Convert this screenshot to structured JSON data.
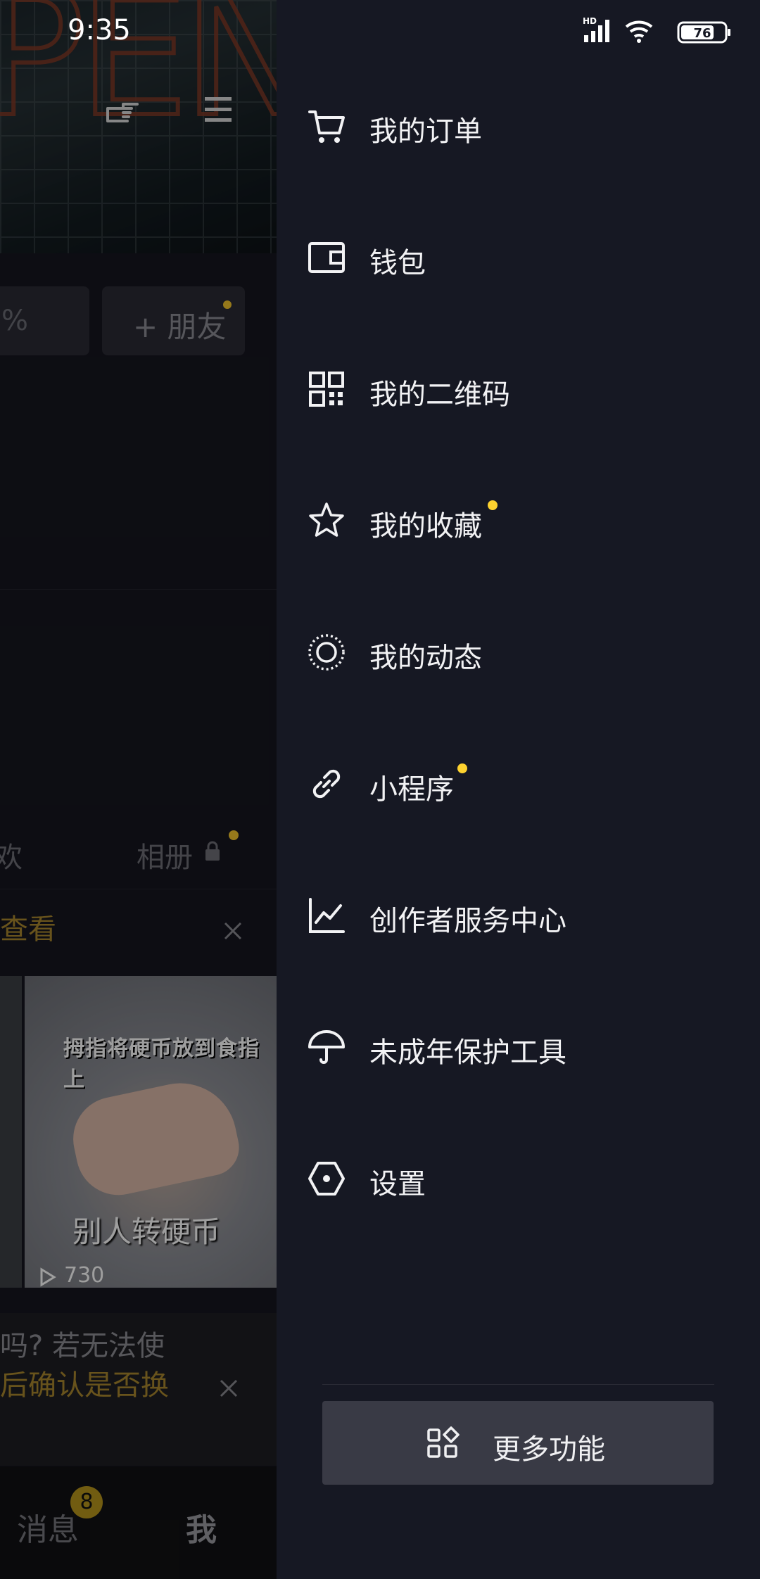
{
  "status_bar": {
    "time": "9:35",
    "battery": "76",
    "network": "HD"
  },
  "background_page": {
    "pill_left_text": "%",
    "add_friend_label": "+ 朋友",
    "tab_partial": "欢",
    "tab_album": "相册",
    "promo_text": "查看",
    "video": {
      "caption_top": "拇指将硬币放到食指上",
      "caption_bottom": "别人转硬币",
      "plays": "730"
    },
    "notice_line1": "吗? 若无法使",
    "notice_line2": "后确认是否换",
    "nav_messages": "消息",
    "nav_messages_badge": "8",
    "nav_me": "我"
  },
  "drawer": {
    "items": [
      {
        "label": "我的订单",
        "icon": "cart-icon"
      },
      {
        "label": "钱包",
        "icon": "wallet-icon"
      },
      {
        "label": "我的二维码",
        "icon": "qr-code-icon"
      },
      {
        "label": "我的收藏",
        "icon": "star-icon"
      },
      {
        "label": "我的动态",
        "icon": "moments-icon"
      },
      {
        "label": "小程序",
        "icon": "link-icon"
      },
      {
        "label": "创作者服务中心",
        "icon": "chart-icon"
      },
      {
        "label": "未成年保护工具",
        "icon": "umbrella-icon"
      },
      {
        "label": "设置",
        "icon": "settings-icon"
      }
    ],
    "more_label": "更多功能"
  },
  "colors": {
    "drawer_bg": "#161823",
    "accent_dot": "#fdd22f",
    "promo": "#a8872e"
  }
}
